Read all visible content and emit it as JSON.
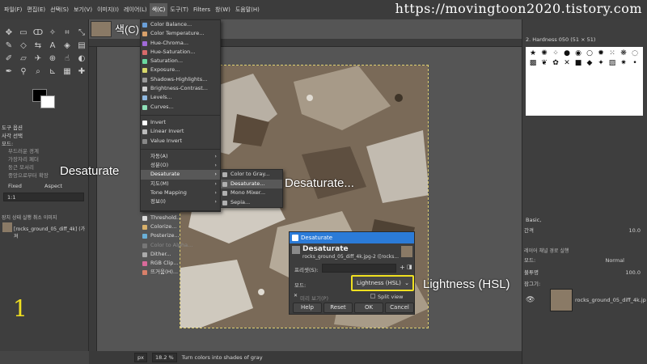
{
  "menubar": {
    "items": [
      "파일(F)",
      "편집(E)",
      "선택(S)",
      "보기(V)",
      "이미지(I)",
      "레이어(L)",
      "색(C)",
      "도구(T)",
      "Filters",
      "창(W)",
      "도움말(H)"
    ],
    "active_index": 6
  },
  "watermark": "https://movingtoon2020.tistory.com",
  "color_menu": {
    "items": [
      {
        "label": "Color Balance...",
        "type": "item",
        "icon": "#6a9fd8"
      },
      {
        "label": "Color Temperature...",
        "type": "item",
        "icon": "#d8a06a"
      },
      {
        "label": "Hue-Chroma...",
        "type": "item",
        "icon": "#a06ad8"
      },
      {
        "label": "Hue-Saturation...",
        "type": "item",
        "icon": "#d86a6a"
      },
      {
        "label": "Saturation...",
        "type": "item",
        "icon": "#6ad8a0"
      },
      {
        "label": "Exposure...",
        "type": "item",
        "icon": "#d8d86a"
      },
      {
        "label": "Shadows-Highlights...",
        "type": "item",
        "icon": "#9a9a9a"
      },
      {
        "label": "Brightness-Contrast...",
        "type": "item",
        "icon": "#cfcfcf"
      },
      {
        "label": "Levels...",
        "type": "item",
        "icon": "#8fb8e0"
      },
      {
        "label": "Curves...",
        "type": "item",
        "icon": "#8fe0b8"
      },
      {
        "type": "sep"
      },
      {
        "label": "Invert",
        "type": "item",
        "icon": "#ffffff"
      },
      {
        "label": "Linear Invert",
        "type": "item",
        "icon": "#bbbbbb"
      },
      {
        "label": "Value Invert",
        "type": "item",
        "icon": "#888888"
      },
      {
        "type": "sep"
      },
      {
        "label": "자동(A)",
        "type": "sub"
      },
      {
        "label": "성분(O)",
        "type": "sub"
      },
      {
        "label": "Desaturate",
        "type": "sub",
        "highlighted": true
      },
      {
        "label": "지도(M)",
        "type": "sub"
      },
      {
        "label": "Tone Mapping",
        "type": "sub"
      },
      {
        "label": "정보(I)",
        "type": "sub"
      },
      {
        "type": "sep"
      },
      {
        "label": "Threshold...",
        "type": "item",
        "icon": "#dddddd"
      },
      {
        "label": "Colorize...",
        "type": "item",
        "icon": "#d8b06a"
      },
      {
        "label": "Posterize...",
        "type": "item",
        "icon": "#6ab0d8"
      },
      {
        "label": "Color to Alpha...",
        "type": "item",
        "dim": true,
        "icon": "#777777"
      },
      {
        "label": "Dither...",
        "type": "item",
        "icon": "#aaaaaa"
      },
      {
        "label": "RGB Clip...",
        "type": "item",
        "icon": "#d86a9a"
      },
      {
        "label": "뜨거움(H)...",
        "type": "item",
        "icon": "#d8806a"
      }
    ]
  },
  "desaturate_submenu": {
    "items": [
      {
        "label": "Color to Gray...",
        "highlighted": false
      },
      {
        "label": "Desaturate...",
        "highlighted": true
      },
      {
        "label": "Mono Mixer...",
        "highlighted": false
      },
      {
        "label": "Sepia...",
        "highlighted": false
      }
    ]
  },
  "dialog": {
    "window_title": "Desaturate",
    "heading": "Desaturate",
    "subheading": "rocks_ground_05_diff_4k.jpg-2 ([rocks...",
    "presets_label": "프리셋(S):",
    "mode_label": "모드:",
    "mode_value": "Lightness (HSL)",
    "preview_label": "미리 보기(P)",
    "split_view_label": "Split view",
    "buttons": {
      "help": "Help",
      "reset": "Reset",
      "ok": "OK",
      "cancel": "Cancel"
    }
  },
  "callouts": {
    "color_menu": "색(C)",
    "desaturate": "Desaturate",
    "desaturate_dots": "Desaturate...",
    "lightness": "Lightness (HSL)",
    "step": "1"
  },
  "toolbox": {
    "options_title": "도구 옵션",
    "section": "사각 선택",
    "mode_label": "모드:",
    "options": [
      "부드러운 경계",
      "가장자리 페더",
      "둥근 모서리",
      "중앙으로부터 확장"
    ],
    "fixed_label": "Fixed",
    "aspect_label": "Aspect",
    "ratio_value": "1:1",
    "layers_tabs": "장치 상태 실행 취소 이미지",
    "image_item": "[rocks_ground_05_diff_4k] (가져"
  },
  "right_panel": {
    "brush_name": "2. Hardness 050 (51 × 51)",
    "preset": "Basic,",
    "spacing_label": "간격",
    "spacing_value": "10.0",
    "tabs": "레이어 채널 경로 실행",
    "mode_label": "모드:",
    "mode_value": "Normal",
    "opacity_label": "불투명",
    "opacity_value": "100.0",
    "lock_label": "잠그기:",
    "layer_name": "rocks_ground_05_diff_4k.jp"
  },
  "statusbar": {
    "unit": "px",
    "zoom": "18.2 %",
    "message": "Turn colors into shades of gray"
  },
  "colors": {
    "dialog_title": "#2b7bd8",
    "highlight_box": "#f0e020",
    "menu_highlight": "#585858"
  }
}
